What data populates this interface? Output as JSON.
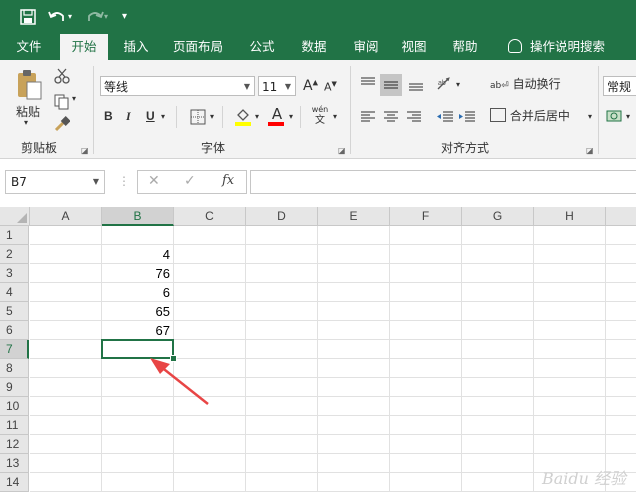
{
  "quick_access": {
    "save_icon": "save-icon",
    "undo_icon": "undo-icon",
    "redo_icon": "redo-icon",
    "customize_icon": "customize-icon"
  },
  "tabs": [
    {
      "label": "文件"
    },
    {
      "label": "开始",
      "active": true
    },
    {
      "label": "插入"
    },
    {
      "label": "页面布局"
    },
    {
      "label": "公式"
    },
    {
      "label": "数据"
    },
    {
      "label": "审阅"
    },
    {
      "label": "视图"
    },
    {
      "label": "帮助"
    }
  ],
  "tell_me": {
    "label": "操作说明搜索",
    "icon": "lightbulb-icon"
  },
  "ribbon": {
    "clipboard": {
      "paste_label": "粘贴",
      "group_label": "剪贴板"
    },
    "font": {
      "font_name": "等线",
      "font_size": "11",
      "group_label": "字体",
      "bold": "B",
      "italic": "I",
      "underline": "U",
      "grow": "A",
      "shrink": "A",
      "color_letter": "A",
      "phonetic_top": "wén",
      "phonetic_bottom": "文"
    },
    "alignment": {
      "wrap_label": "自动换行",
      "merge_label": "合并后居中",
      "group_label": "对齐方式"
    },
    "number": {
      "format": "常规"
    },
    "colors": {
      "accent": "#217346",
      "fill_color": "#ffff00",
      "font_color": "#ff0000"
    }
  },
  "formula_bar": {
    "name_box": "B7",
    "fx_label": "fx",
    "formula": ""
  },
  "sheet": {
    "columns": [
      "A",
      "B",
      "C",
      "D",
      "E",
      "F",
      "G",
      "H"
    ],
    "rows": [
      "1",
      "2",
      "3",
      "4",
      "5",
      "6",
      "7",
      "8",
      "9",
      "10",
      "11",
      "12",
      "13",
      "14"
    ],
    "column_b_values": [
      "",
      "4",
      "76",
      "6",
      "65",
      "67"
    ],
    "selected_cell": "B7",
    "annotation": {
      "type": "arrow",
      "color": "#e84545",
      "points_to": "B7"
    }
  },
  "watermark": "Baidu 经验"
}
